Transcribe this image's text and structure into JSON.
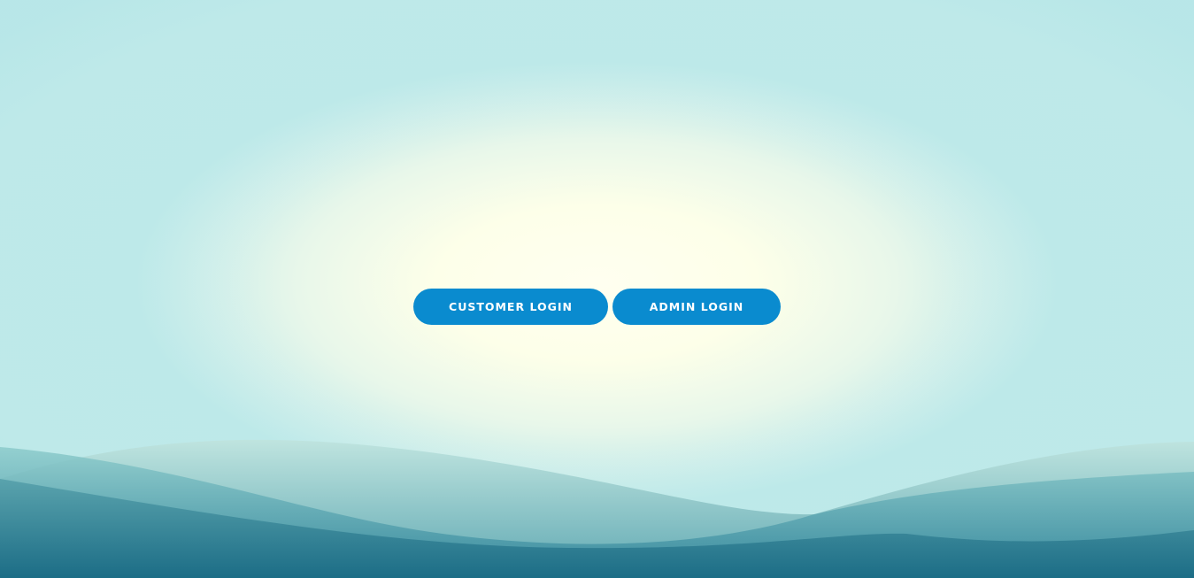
{
  "login": {
    "customer_label": "CUSTOMER LOGIN",
    "admin_label": "ADMIN LOGIN"
  },
  "colors": {
    "button": "#0a8bcf",
    "button_text": "#ffffff",
    "sky_center": "#fffff0",
    "sky_edge": "#bde9e9",
    "wave_light": "#a9dcd9",
    "wave_dark": "#1e6f86"
  }
}
